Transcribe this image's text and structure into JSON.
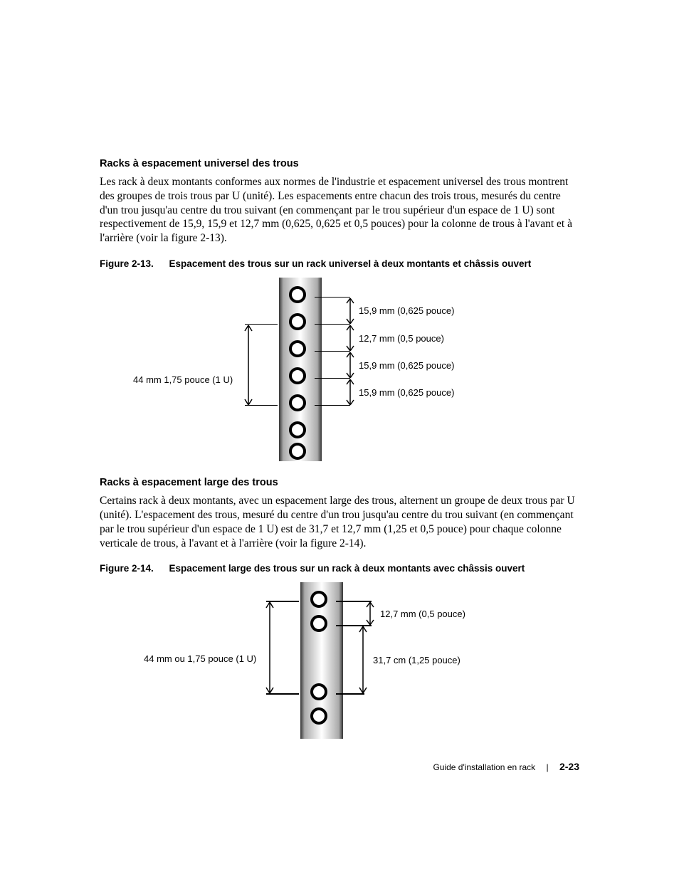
{
  "section1": {
    "heading": "Racks à espacement universel des trous",
    "body": "Les rack à deux montants conformes aux normes de l'industrie et espacement universel des trous montrent des groupes de trois trous par U (unité). Les espacements entre chacun des trois trous, mesurés du centre d'un trou jusqu'au centre du trou suivant (en commençant par le trou supérieur d'un espace de 1 U) sont respectivement de 15,9, 15,9 et 12,7 mm (0,625, 0,625 et 0,5 pouces) pour la colonne de trous à l'avant et à l'arrière (voir la figure 2-13)."
  },
  "figure1": {
    "caption_num": "Figure 2-13.",
    "caption_text": "Espacement des trous sur un rack universel à deux montants et châssis ouvert",
    "left_label": "44 mm 1,75 pouce (1 U)",
    "dims": [
      "15,9 mm (0,625 pouce)",
      "12,7 mm (0,5 pouce)",
      "15,9 mm (0,625 pouce)",
      "15,9 mm (0,625 pouce)"
    ]
  },
  "section2": {
    "heading": "Racks à espacement large des trous",
    "body": "Certains rack à deux montants, avec un espacement large des trous, alternent un groupe de deux trous par U (unité). L'espacement des trous, mesuré du centre d'un trou jusqu'au centre du trou suivant (en commençant par le trou supérieur d'un espace de 1 U) est de 31,7 et 12,7 mm (1,25 et 0,5 pouce) pour chaque colonne verticale de trous, à l'avant et à l'arrière (voir la figure 2-14)."
  },
  "figure2": {
    "caption_num": "Figure 2-14.",
    "caption_text": "Espacement large des trous sur un rack à deux montants avec châssis ouvert",
    "left_label": "44 mm ou 1,75 pouce (1 U)",
    "dims": [
      "12,7 mm (0,5 pouce)",
      "31,7 cm (1,25 pouce)"
    ]
  },
  "footer": {
    "title": "Guide d'installation en rack",
    "page": "2-23"
  }
}
